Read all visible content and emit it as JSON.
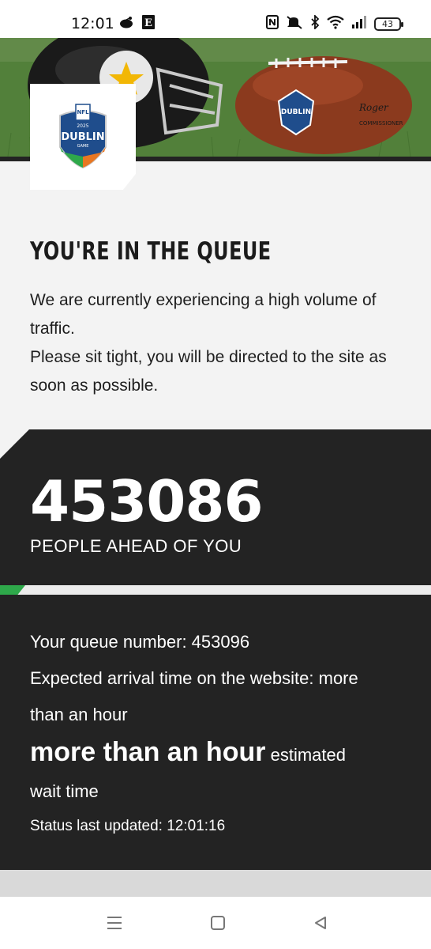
{
  "status_bar": {
    "time": "12:01",
    "battery": "43",
    "icons": [
      "reddit-icon",
      "app-e-icon",
      "nfc-icon",
      "mute-icon",
      "bluetooth-icon",
      "wifi-icon",
      "signal-icon",
      "battery-icon"
    ]
  },
  "hero": {
    "logo": {
      "league": "NFL",
      "text": "DUBLIN",
      "sub": "GAME",
      "year": "2025"
    },
    "colors": {
      "accent_green": "#2ea84a",
      "dark": "#232323",
      "logo_blue": "#1f4d8c",
      "logo_orange": "#e87722"
    }
  },
  "intro": {
    "title": "YOU'RE IN THE QUEUE",
    "line1": "We are currently experiencing a high volume of traffic.",
    "line2": "Please sit tight, you will be directed to the site as soon as possible."
  },
  "queue": {
    "ahead_count": "453086",
    "ahead_label": "PEOPLE AHEAD OF YOU"
  },
  "details": {
    "queue_number": "Your queue number: 453096",
    "expected_arrival_1": "Expected arrival time on the website: more",
    "expected_arrival_2": "than an hour",
    "wait_value": "more than an hour",
    "wait_suffix": "estimated",
    "wait_suffix_2": "wait time",
    "last_updated": "Status last updated: 12:01:16"
  }
}
